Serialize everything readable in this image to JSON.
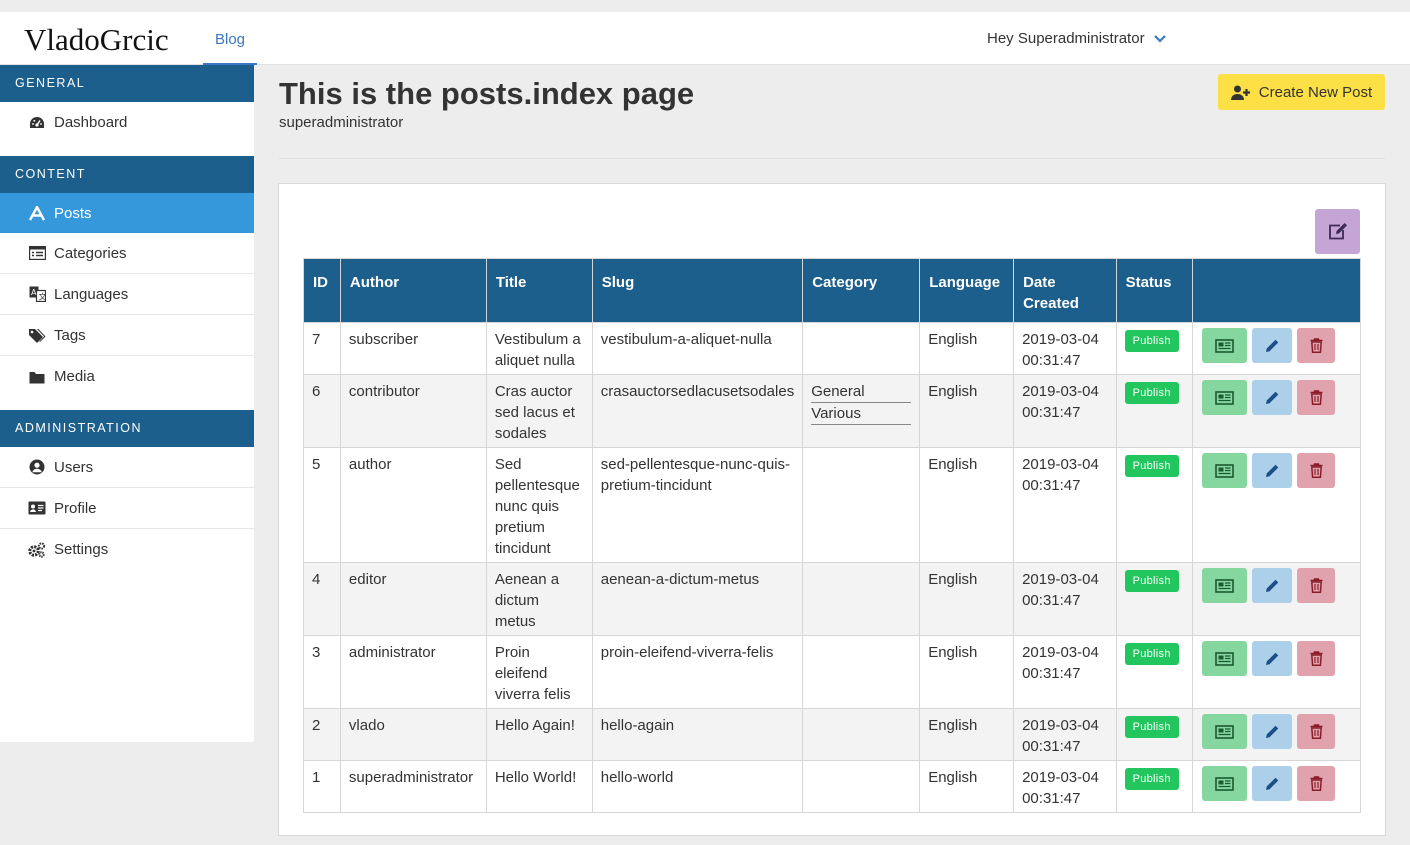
{
  "brand": "VladoGrcic",
  "nav": {
    "blog": "Blog",
    "user_greeting": "Hey Superadministrator"
  },
  "sidebar": {
    "general_header": "GENERAL",
    "content_header": "CONTENT",
    "admin_header": "ADMINISTRATION",
    "general_items": [
      {
        "label": "Dashboard",
        "icon": "dashboard-icon"
      }
    ],
    "content_items": [
      {
        "label": "Posts",
        "icon": "font-icon",
        "active": true
      },
      {
        "label": "Categories",
        "icon": "list-icon"
      },
      {
        "label": "Languages",
        "icon": "language-icon"
      },
      {
        "label": "Tags",
        "icon": "tags-icon"
      },
      {
        "label": "Media",
        "icon": "folder-icon"
      }
    ],
    "admin_items": [
      {
        "label": "Users",
        "icon": "user-circle-icon"
      },
      {
        "label": "Profile",
        "icon": "id-card-icon"
      },
      {
        "label": "Settings",
        "icon": "cogs-icon"
      }
    ]
  },
  "page": {
    "title": "This is the posts.index page",
    "subtitle": "superadministrator",
    "create_button": "Create New Post"
  },
  "table": {
    "headers": [
      "ID",
      "Author",
      "Title",
      "Slug",
      "Category",
      "Language",
      "Date Created",
      "Status",
      ""
    ],
    "rows": [
      {
        "id": "7",
        "author": "subscriber",
        "title": "Vestibulum a aliquet nulla",
        "slug": "vestibulum-a-aliquet-nulla",
        "categories": [],
        "language": "English",
        "date": "2019-03-04 00:31:47",
        "status": "Publish"
      },
      {
        "id": "6",
        "author": "contributor",
        "title": "Cras auctor sed lacus et sodales",
        "slug": "crasauctorsedlacusetsodales",
        "categories": [
          "General",
          "Various"
        ],
        "language": "English",
        "date": "2019-03-04 00:31:47",
        "status": "Publish"
      },
      {
        "id": "5",
        "author": "author",
        "title": "Sed pellentesque nunc quis pretium tincidunt",
        "slug": "sed-pellentesque-nunc-quis-pretium-tincidunt",
        "categories": [],
        "language": "English",
        "date": "2019-03-04 00:31:47",
        "status": "Publish"
      },
      {
        "id": "4",
        "author": "editor",
        "title": "Aenean a dictum metus",
        "slug": "aenean-a-dictum-metus",
        "categories": [],
        "language": "English",
        "date": "2019-03-04 00:31:47",
        "status": "Publish"
      },
      {
        "id": "3",
        "author": "administrator",
        "title": "Proin eleifend viverra felis",
        "slug": "proin-eleifend-viverra-felis",
        "categories": [],
        "language": "English",
        "date": "2019-03-04 00:31:47",
        "status": "Publish"
      },
      {
        "id": "2",
        "author": "vlado",
        "title": "Hello Again!",
        "slug": "hello-again",
        "categories": [],
        "language": "English",
        "date": "2019-03-04 00:31:47",
        "status": "Publish"
      },
      {
        "id": "1",
        "author": "superadministrator",
        "title": "Hello World!",
        "slug": "hello-world",
        "categories": [],
        "language": "English",
        "date": "2019-03-04 00:31:47",
        "status": "Publish"
      }
    ]
  },
  "colors": {
    "sidebar_header": "#1c5e8c",
    "active_item": "#3498db",
    "create_button": "#fde046",
    "publish_badge": "#22c55e",
    "view_button": "#86d6a0",
    "edit_button": "#acd0ea",
    "delete_button": "#e0a3ae",
    "bulk_edit_button": "#c5a4d6"
  }
}
